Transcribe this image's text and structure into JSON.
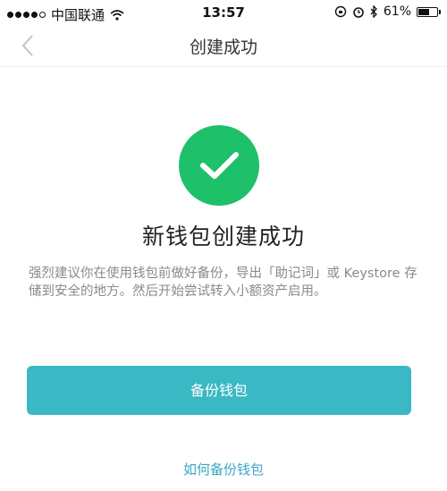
{
  "status_bar": {
    "carrier": "中国联通",
    "time": "13:57",
    "battery_text": "61%",
    "battery_level": 0.61,
    "icons": [
      "signal-dots-icon",
      "wifi-icon",
      "lock-rotation-icon",
      "alarm-icon",
      "bluetooth-icon",
      "battery-icon"
    ]
  },
  "nav": {
    "title": "创建成功",
    "back_icon": "chevron-left-icon"
  },
  "main": {
    "icon": "checkmark-icon",
    "headline": "新钱包创建成功",
    "description": "强烈建议你在使用钱包前做好备份，导出「助记词」或 Keystore 存储到安全的地方。然后开始尝试转入小额资产启用。",
    "backup_button": "备份钱包",
    "help_link": "如何备份钱包"
  },
  "colors": {
    "success_green": "#1fc06a",
    "primary_button": "#3ab8c4",
    "link": "#3aa7c7"
  }
}
